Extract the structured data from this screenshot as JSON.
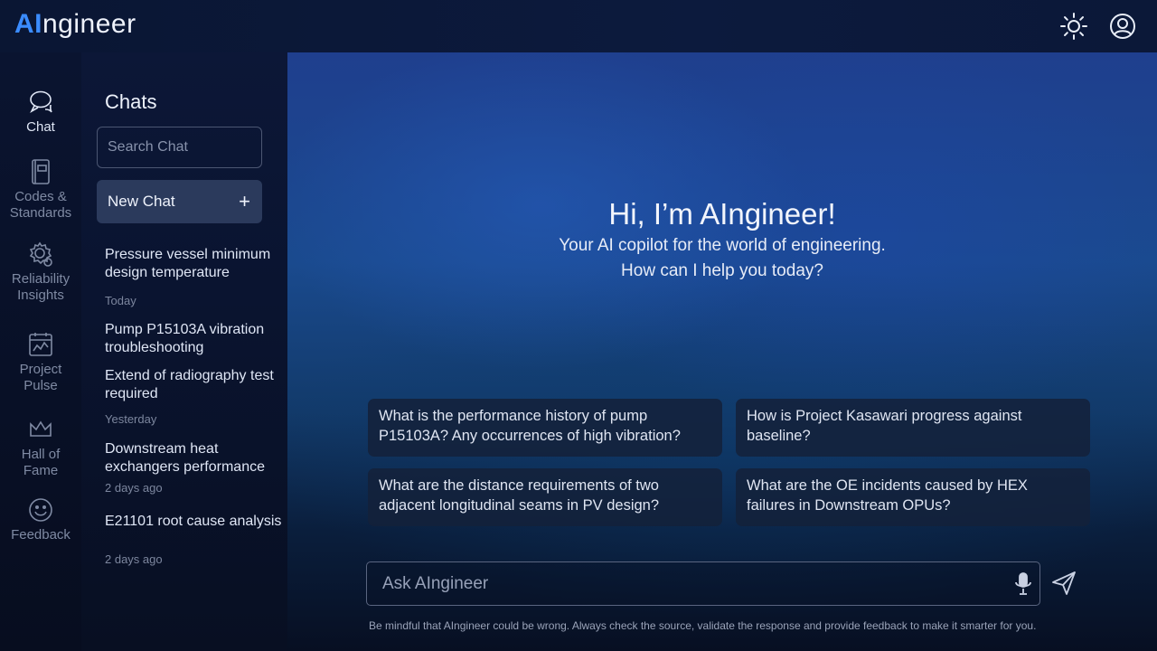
{
  "app": {
    "logo_ai": "AI",
    "logo_rest": "ngineer"
  },
  "topbar": {
    "theme_icon": "sun-icon",
    "profile_icon": "user-circle-icon"
  },
  "rail": {
    "items": [
      {
        "label_lines": [
          "Chat"
        ],
        "icon": "chat-bubbles-icon",
        "active": true
      },
      {
        "label_lines": [
          "Codes &",
          "Standards"
        ],
        "icon": "book-icon",
        "active": false
      },
      {
        "label_lines": [
          "Reliability",
          "Insights"
        ],
        "icon": "gear-insights-icon",
        "active": false
      },
      {
        "label_lines": [
          "Project",
          "Pulse"
        ],
        "icon": "calendar-chart-icon",
        "active": false
      },
      {
        "label_lines": [
          "Hall of",
          "Fame"
        ],
        "icon": "crown-icon",
        "active": false
      },
      {
        "label_lines": [
          "Feedback"
        ],
        "icon": "smiley-icon",
        "active": false
      }
    ],
    "labels": {
      "chat": "Chat",
      "codes1": "Codes &",
      "codes2": "Standards",
      "rel1": "Reliability",
      "rel2": "Insights",
      "proj1": "Project",
      "proj2": "Pulse",
      "hall1": "Hall of",
      "hall2": "Fame",
      "feedback": "Feedback"
    }
  },
  "chats": {
    "title": "Chats",
    "search_placeholder": "Search Chat",
    "new_chat_label": "New Chat",
    "new_chat_icon": "+",
    "entries": [
      {
        "title": "Pressure vessel minimum design temperature",
        "meta": "Today"
      },
      {
        "title": "Pump P15103A vibration troubleshooting",
        "meta": ""
      },
      {
        "title": "Extend of radiography test required",
        "meta": "Yesterday"
      },
      {
        "title": "Downstream heat exchangers performance",
        "meta": "2 days ago"
      },
      {
        "title": "E21101 root cause analysis",
        "meta": "2 days ago"
      }
    ]
  },
  "main": {
    "greeting_title": "Hi, I’m AIngineer!",
    "greeting_line1": "Your AI copilot for the world of engineering.",
    "greeting_line2": "How can I help you today?",
    "suggestions": [
      "What is the performance history of pump P15103A? Any occurrences of high vibration?",
      "How is Project Kasawari progress against baseline?",
      "What are the distance requirements of two adjacent longitudinal seams in PV design?",
      "What are the OE incidents caused by HEX failures in Downstream OPUs?"
    ],
    "ask_placeholder": "Ask AIngineer",
    "mic_icon": "microphone-icon",
    "send_icon": "send-icon",
    "disclaimer": "Be mindful that AIngineer could be wrong. Always check the source, validate the response and provide feedback to make it smarter for you."
  },
  "colors": {
    "accent": "#3b8cff",
    "panel": "#0a1430",
    "button": "#2b3a5c"
  }
}
